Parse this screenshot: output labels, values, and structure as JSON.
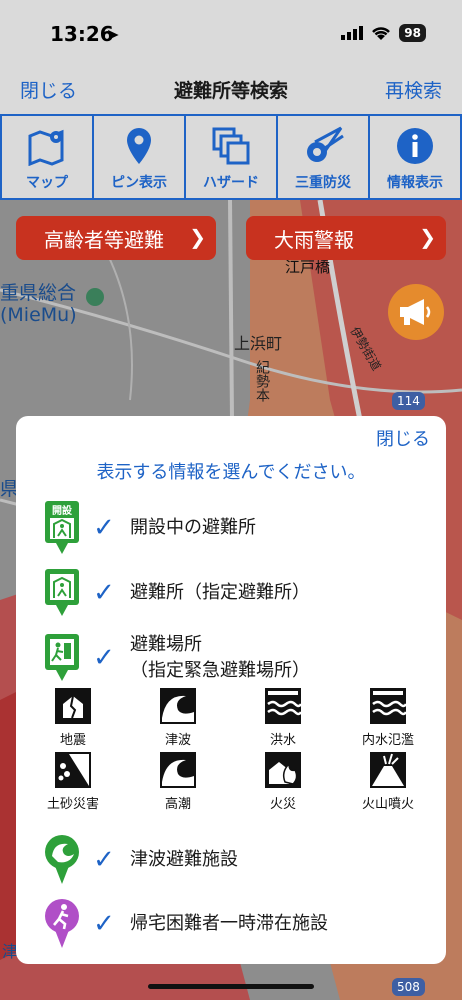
{
  "status": {
    "time": "13:26",
    "battery": "98"
  },
  "nav": {
    "close": "閉じる",
    "title": "避難所等検索",
    "research": "再検索"
  },
  "toolbar": [
    {
      "label": "マップ",
      "icon": "map-pin-icon"
    },
    {
      "label": "ピン表示",
      "icon": "pin-icon"
    },
    {
      "label": "ハザード",
      "icon": "hazard-layers-icon"
    },
    {
      "label": "三重防災",
      "icon": "mie-bousai-icon"
    },
    {
      "label": "情報表示",
      "icon": "info-icon"
    }
  ],
  "chips": [
    {
      "label": "高齢者等避難"
    },
    {
      "label": "大雨警報"
    }
  ],
  "map": {
    "labels": {
      "bridge": "江戸橋",
      "prefecture": "重県総合",
      "museum": "(MieMu)",
      "town": "上浜町",
      "road1": "紀勢本",
      "road2": "伊勢街道",
      "route": "114",
      "route2": "508",
      "left": "県",
      "bottom": "津"
    }
  },
  "panel": {
    "close": "閉じる",
    "title": "表示する情報を選んでください。",
    "options": [
      {
        "label": "開設中の避難所",
        "icon": "open-shelter-icon",
        "badge": "開設"
      },
      {
        "label": "避難所（指定避難所）",
        "icon": "shelter-icon"
      },
      {
        "label": "避難場所",
        "label2": "（指定緊急避難場所）",
        "icon": "evacuation-site-icon"
      },
      {
        "label": "津波避難施設",
        "icon": "tsunami-facility-icon"
      },
      {
        "label": "帰宅困難者一時滞在施設",
        "icon": "stranded-commuter-icon"
      }
    ],
    "hazards": [
      {
        "label": "地震",
        "icon": "earthquake-icon"
      },
      {
        "label": "津波",
        "icon": "tsunami-icon"
      },
      {
        "label": "洪水",
        "icon": "flood-icon"
      },
      {
        "label": "内水氾濫",
        "icon": "inland-flood-icon"
      },
      {
        "label": "土砂災害",
        "icon": "landslide-icon"
      },
      {
        "label": "高潮",
        "icon": "storm-surge-icon"
      },
      {
        "label": "火災",
        "icon": "fire-icon"
      },
      {
        "label": "火山噴火",
        "icon": "volcano-icon"
      }
    ]
  },
  "colors": {
    "accent": "#1e63c6",
    "alert": "#c8321f",
    "green": "#2ea03a",
    "purple": "#b04fc7"
  }
}
